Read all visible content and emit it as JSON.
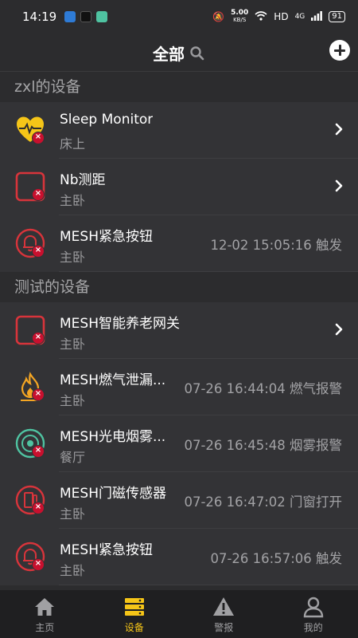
{
  "status_bar": {
    "time": "14:19",
    "network_speed": "5.00",
    "network_unit": "KB/S",
    "hd": "HD",
    "signal": "4G",
    "battery": "91"
  },
  "header": {
    "title": "全部"
  },
  "sections": [
    {
      "title": "zxl的设备",
      "devices": [
        {
          "name": "Sleep Monitor",
          "room": "床上",
          "status": "",
          "icon": "heart-monitor-icon",
          "has_chevron": true
        },
        {
          "name": "Nb测距",
          "room": "主卧",
          "status": "",
          "icon": "square-device-icon",
          "has_chevron": true
        },
        {
          "name": "MESH紧急按钮",
          "room": "主卧",
          "status": "12-02 15:05:16 触发",
          "icon": "bell-icon",
          "has_chevron": false
        }
      ]
    },
    {
      "title": "测试的设备",
      "devices": [
        {
          "name": "MESH智能养老网关",
          "room": "主卧",
          "status": "",
          "icon": "square-device-icon",
          "has_chevron": true
        },
        {
          "name": "MESH燃气泄漏...",
          "room": "主卧",
          "status": "07-26 16:44:04 燃气报警",
          "icon": "gas-flame-icon",
          "has_chevron": false
        },
        {
          "name": "MESH光电烟雾...",
          "room": "餐厅",
          "status": "07-26 16:45:48 烟雾报警",
          "icon": "smoke-detector-icon",
          "has_chevron": false
        },
        {
          "name": "MESH门磁传感器",
          "room": "主卧",
          "status": "07-26 16:47:02 门窗打开",
          "icon": "door-sensor-icon",
          "has_chevron": false
        },
        {
          "name": "MESH紧急按钮",
          "room": "主卧",
          "status": "07-26 16:57:06 触发",
          "icon": "bell-icon",
          "has_chevron": false
        }
      ]
    }
  ],
  "offline_badge": "×",
  "tabbar": {
    "items": [
      {
        "label": "主页",
        "icon": "home-icon",
        "active": false
      },
      {
        "label": "设备",
        "icon": "devices-icon",
        "active": true
      },
      {
        "label": "警报",
        "icon": "warning-icon",
        "active": false
      },
      {
        "label": "我的",
        "icon": "user-icon",
        "active": false
      }
    ]
  },
  "colors": {
    "accent": "#f5c518",
    "alert_red": "#d8343b",
    "badge_red": "#c8102e",
    "background": "#2c2c2e",
    "row": "#333336"
  }
}
